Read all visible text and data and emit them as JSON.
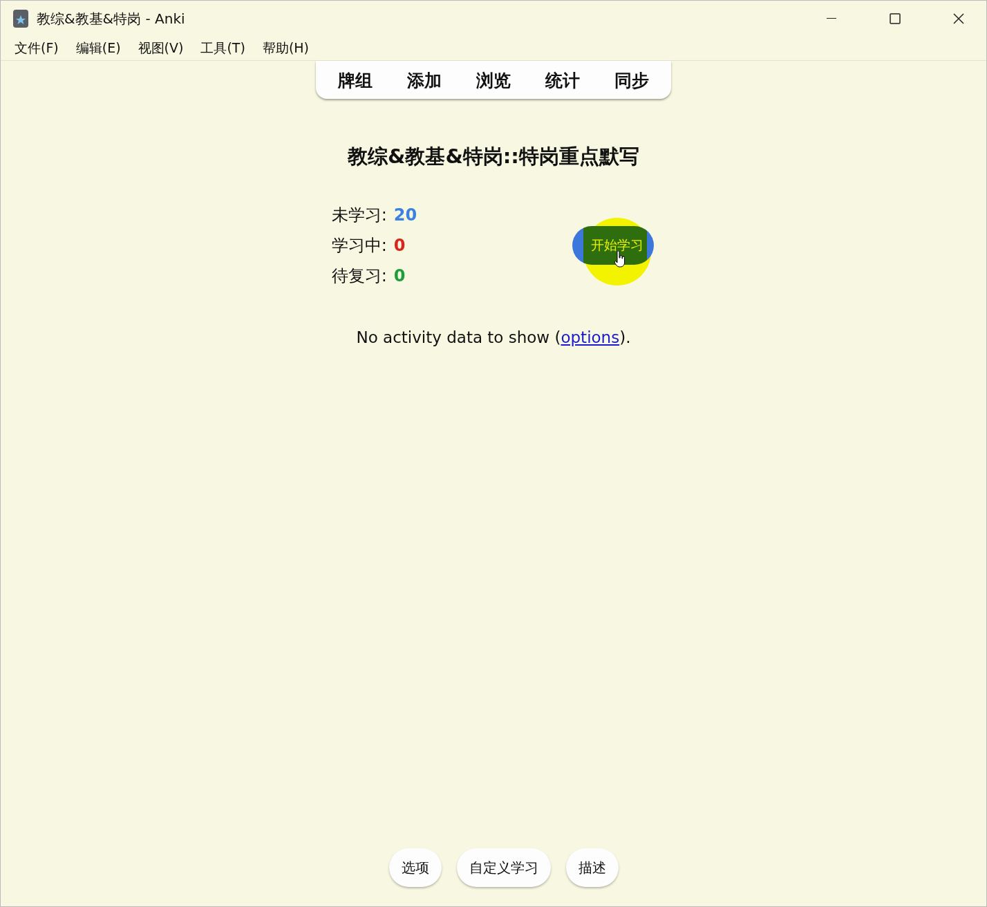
{
  "window": {
    "title": "教综&教基&特岗 - Anki"
  },
  "menu": [
    "文件(F)",
    "编辑(E)",
    "视图(V)",
    "工具(T)",
    "帮助(H)"
  ],
  "toolbar": [
    "牌组",
    "添加",
    "浏览",
    "统计",
    "同步"
  ],
  "deck_title": "教综&教基&特岗::特岗重点默写",
  "counts": [
    {
      "label": "未学习:",
      "value": "20",
      "color": "#3b82e0"
    },
    {
      "label": "学习中:",
      "value": "0",
      "color": "#d9261c"
    },
    {
      "label": "待复习:",
      "value": "0",
      "color": "#1f9d3a"
    }
  ],
  "study_button": "开始学习",
  "activity": {
    "before": "No activity data to show (",
    "link": "options",
    "after": ")."
  },
  "bottom_buttons": [
    "选项",
    "自定义学习",
    "描述"
  ]
}
